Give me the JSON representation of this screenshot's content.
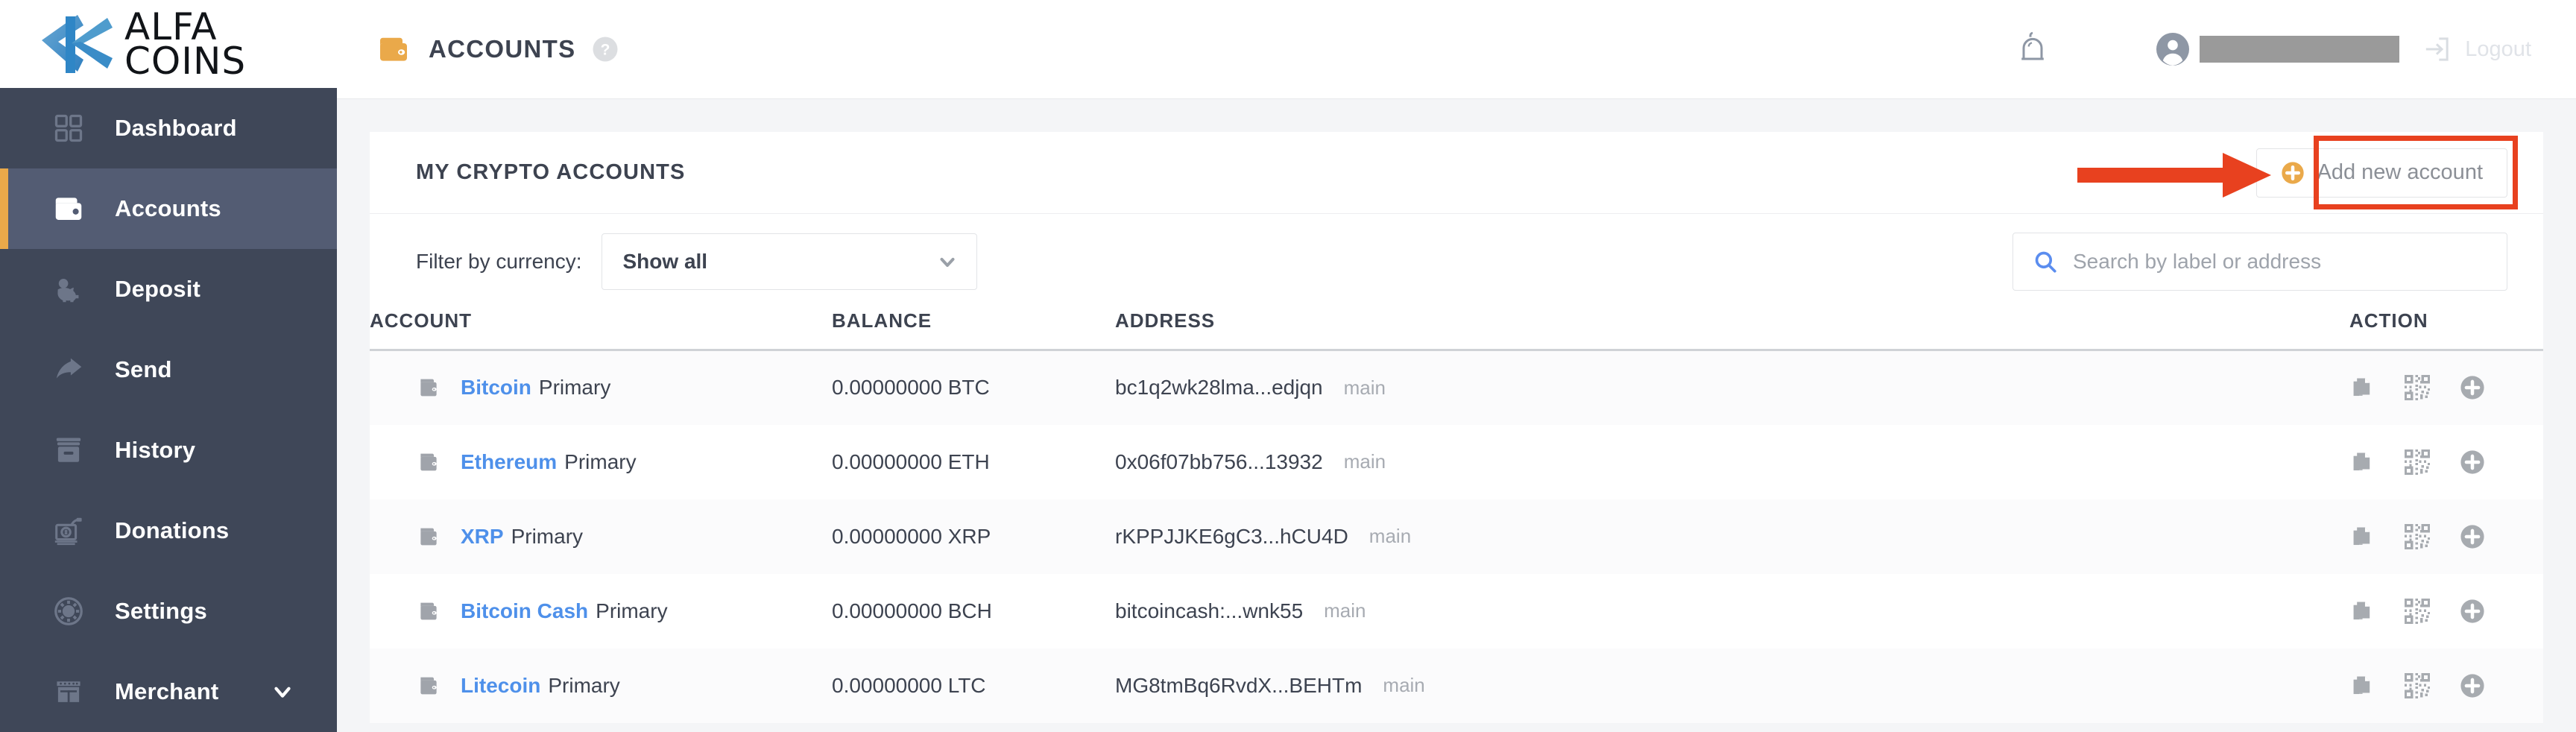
{
  "brand": {
    "line1": "ALFA",
    "line2": "COINS",
    "logo_color": "#4a90c4",
    "accent": "#eaa94a"
  },
  "sidebar": {
    "items": [
      {
        "label": "Dashboard",
        "icon": "grid-icon",
        "active": false,
        "expandable": false
      },
      {
        "label": "Accounts",
        "icon": "wallet-icon",
        "active": true,
        "expandable": false
      },
      {
        "label": "Deposit",
        "icon": "piggy-bank-icon",
        "active": false,
        "expandable": false
      },
      {
        "label": "Send",
        "icon": "share-arrow-icon",
        "active": false,
        "expandable": false
      },
      {
        "label": "History",
        "icon": "archive-box-icon",
        "active": false,
        "expandable": false
      },
      {
        "label": "Donations",
        "icon": "donation-icon",
        "active": false,
        "expandable": false
      },
      {
        "label": "Settings",
        "icon": "gear-icon",
        "active": false,
        "expandable": false
      },
      {
        "label": "Merchant",
        "icon": "store-icon",
        "active": false,
        "expandable": true
      }
    ]
  },
  "topbar": {
    "page_icon": "wallet-icon",
    "page_title": "ACCOUNTS",
    "help_icon": "question-circle-icon",
    "bell_icon": "bell-icon",
    "avatar_icon": "user-avatar-icon",
    "username_redacted": "",
    "logout_icon": "logout-arrow-icon",
    "logout_label": "Logout"
  },
  "card": {
    "title": "MY CRYPTO ACCOUNTS",
    "add_button": {
      "label": "Add new account",
      "icon": "plus-circle-icon"
    },
    "annotation": {
      "type": "arrow-and-box",
      "color": "#e8411f"
    }
  },
  "filters": {
    "label": "Filter by currency:",
    "select": {
      "value": "Show all",
      "chevron": "chevron-down-icon"
    },
    "search": {
      "placeholder": "Search by label or address",
      "value": "",
      "icon": "search-icon"
    }
  },
  "table": {
    "headers": [
      "ACCOUNT",
      "BALANCE",
      "ADDRESS",
      "ACTION"
    ],
    "row_actions": [
      "copy-icon",
      "qr-code-icon",
      "plus-circle-icon"
    ],
    "rows": [
      {
        "icon": "wallet-icon",
        "currency": "Bitcoin",
        "kind": "Primary",
        "balance": "0.00000000 BTC",
        "address": "bc1q2wk28lma...edjqn",
        "tag": "main"
      },
      {
        "icon": "wallet-icon",
        "currency": "Ethereum",
        "kind": "Primary",
        "balance": "0.00000000 ETH",
        "address": "0x06f07bb756...13932",
        "tag": "main"
      },
      {
        "icon": "wallet-icon",
        "currency": "XRP",
        "kind": "Primary",
        "balance": "0.00000000 XRP",
        "address": "rKPPJJKE6gC3...hCU4D",
        "tag": "main"
      },
      {
        "icon": "wallet-icon",
        "currency": "Bitcoin Cash",
        "kind": "Primary",
        "balance": "0.00000000 BCH",
        "address": "bitcoincash:...wnk55",
        "tag": "main"
      },
      {
        "icon": "wallet-icon",
        "currency": "Litecoin",
        "kind": "Primary",
        "balance": "0.00000000 LTC",
        "address": "MG8tmBq6RvdX...BEHTm",
        "tag": "main"
      }
    ]
  }
}
